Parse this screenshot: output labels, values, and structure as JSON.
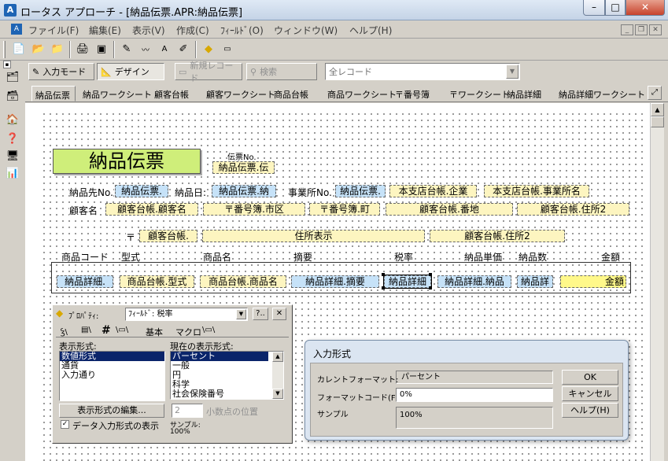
{
  "window": {
    "title": "ロータス アプローチ - [納品伝票.APR:納品伝票]",
    "min_glyph": "–",
    "max_glyph": "□",
    "close_glyph": "✕"
  },
  "menu": [
    "ファイル(F)",
    "編集(E)",
    "表示(V)",
    "作成(C)",
    "ﾌｨｰﾙﾄﾞ(O)",
    "ウィンドウ(W)",
    "ヘルプ(H)"
  ],
  "mode_bar": {
    "input_mode": "入力モード",
    "design": "デザイン",
    "new_record": "新規レコード",
    "search": "検索",
    "record_filter": "全レコード"
  },
  "tabs": [
    "納品伝票",
    "納品ワークシート",
    "顧客台帳",
    "顧客ワークシート",
    "商品台帳",
    "商品ワークシート",
    "〒番号簿",
    "〒ワークシート",
    "納品詳細",
    "納品詳細ワークシート"
  ],
  "form": {
    "title": "納品伝票",
    "slip_no_label": "伝票No.",
    "slip_no_field": "納品伝票.伝",
    "deliver_to_label": "納品先No.",
    "deliver_to_field": "納品伝票.",
    "date_label": "納品日:",
    "date_field": "納品伝票.納",
    "office_label": "事業所No.",
    "office_field": "納品伝票.",
    "branch_company": "本支店台帳.企業",
    "branch_office": "本支店台帳.事業所名",
    "customer_label": "顧客名",
    "customer_field": "顧客台帳.顧客名",
    "city_field": "〒番号簿.市区",
    "town_field": "〒番号簿.町",
    "banchi_field": "顧客台帳.番地",
    "address2_field": "顧客台帳.住所2",
    "postal_mark": "〒",
    "postal_field": "顧客台帳.",
    "address_display": "住所表示",
    "address2_field_b": "顧客台帳.住所2",
    "col_headers": [
      "商品コード",
      "型式",
      "商品名",
      "摘要",
      "税率",
      "納品単価",
      "納品数",
      "金額"
    ],
    "row_fields": [
      "納品詳細.",
      "商品台帳.型式",
      "商品台帳.商品名",
      "納品詳細.摘要",
      "納品詳細",
      "納品詳細.納品",
      "納品詳",
      "金額"
    ]
  },
  "properties": {
    "title": "ﾌﾟﾛﾊﾟﾃｨ:",
    "field_select": "ﾌｨｰﾙﾄﾞ: 税率",
    "help_btn": "?..",
    "close_btn": "✕",
    "tab_basic": "基本",
    "tab_macro": "マクロ",
    "display_format_label": "表示形式:",
    "display_formats": [
      "数値形式",
      "通貨",
      "入力通り"
    ],
    "current_format_label": "現在の表示形式:",
    "current_formats": [
      "パーセント",
      "一般",
      "円",
      "科学",
      "社会保険番号"
    ],
    "edit_format_btn": "表示形式の編集...",
    "decimal_value": "2",
    "decimal_label": "小数点の位置",
    "data_input_checkbox": "データ入力形式の表示",
    "sample_label": "サンプル:",
    "sample_value": "100%"
  },
  "dialog": {
    "title": "入力形式",
    "current_format_label": "カレントフォーマット:",
    "current_format_value": "パーセント",
    "format_code_label": "フォーマットコード(F):",
    "format_code_value": "0%",
    "sample_label": "サンプル",
    "sample_value": "100%",
    "ok": "OK",
    "cancel": "キャンセル(C)",
    "help": "ヘルプ(H)"
  }
}
